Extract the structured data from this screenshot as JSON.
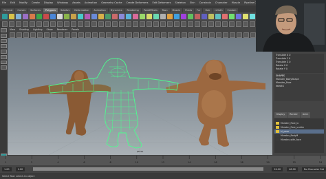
{
  "menubar": [
    "File",
    "Edit",
    "Modify",
    "Create",
    "Display",
    "Windows",
    "Assets",
    "Animation",
    "Geometry Cache",
    "Create Deformers",
    "Edit Deformers",
    "Skeleton",
    "Skin",
    "Constrain",
    "Character",
    "Muscle",
    "Pipeline Cache",
    "Help"
  ],
  "shelf_tabs": [
    {
      "label": "General",
      "active": false
    },
    {
      "label": "Curves",
      "active": false
    },
    {
      "label": "Surfaces",
      "active": false
    },
    {
      "label": "Polygons",
      "active": true
    },
    {
      "label": "Subdivs",
      "active": false
    },
    {
      "label": "Deformation",
      "active": false
    },
    {
      "label": "Animation",
      "active": false
    },
    {
      "label": "Dynamics",
      "active": false
    },
    {
      "label": "Rendering",
      "active": false
    },
    {
      "label": "PaintEffects",
      "active": false
    },
    {
      "label": "Toon",
      "active": false
    },
    {
      "label": "Muscle",
      "active": false
    },
    {
      "label": "Fluids",
      "active": false
    },
    {
      "label": "Fur",
      "active": false
    },
    {
      "label": "Hair",
      "active": false
    },
    {
      "label": "nCloth",
      "active": false
    },
    {
      "label": "Custom",
      "active": false
    }
  ],
  "shelf_icon_colors": [
    "#2f9c9c",
    "#d8c24a",
    "#7fb2d8",
    "#9a6fc6",
    "#d87a4a",
    "#3aa64a",
    "#c94a4a",
    "#4a86d8",
    "#d8d8d8",
    "#8ab44a",
    "#c9a14a",
    "#4ac9c9",
    "#b45ab4",
    "#6a8ad8",
    "#d8b04a",
    "#4a9a6a",
    "#c96a6a",
    "#8a8ad8",
    "#5ab4d8",
    "#d86a9a",
    "#9ad86a",
    "#d8d86a",
    "#6ad8b0",
    "#b0b0b0",
    "#e0a040",
    "#40a0e0",
    "#a040e0",
    "#60c060",
    "#c06060",
    "#6060c0",
    "#c0c060",
    "#60c0c0",
    "#e07070",
    "#70e070",
    "#7070e0",
    "#e0e070",
    "#70e0e0",
    "#e070e0"
  ],
  "panel_menu": [
    "View",
    "Shading",
    "Lighting",
    "Show",
    "Renderer",
    "Panels"
  ],
  "viewport_label": "persp",
  "channelbox": {
    "rows": [
      "Translate X 0",
      "Translate Y 0",
      "Translate Z 0",
      "Rotate X 0",
      "Rotate Y 0",
      "Rotate Z 0"
    ]
  },
  "shapes": {
    "header": "SHAPES",
    "items": [
      "Monster_BodyShape",
      "Monster_Face",
      "tweak1"
    ]
  },
  "layer_tabs": [
    "Display",
    "Render",
    "Anim"
  ],
  "layers": [
    {
      "name": "Monster_Face_lo",
      "color": "#e3c13a",
      "selected": false
    },
    {
      "name": "Monster_Face_scultm",
      "color": "#e3c13a",
      "selected": false
    },
    {
      "name": "hi_pose",
      "color": "#e3c13a",
      "selected": true
    },
    {
      "name": "Monster_BodyM",
      "color": "#3a3a3a",
      "selected": false
    },
    {
      "name": "Monster_with_face",
      "color": "#3a3a3a",
      "selected": false
    }
  ],
  "timeline_ticks": [
    "1",
    "2",
    "4",
    "6",
    "8",
    "10",
    "12",
    "14",
    "16",
    "18",
    "20",
    "22",
    "24"
  ],
  "range": {
    "start": "1.00",
    "end": "24.00",
    "anim_end": "48.00",
    "char_set": "No Character Set"
  },
  "helpline": "Select Tool: select an object",
  "colors": {
    "wireframe": "#4dfd8e",
    "fur": "#9c6840",
    "fur_dark": "#6f4526"
  }
}
